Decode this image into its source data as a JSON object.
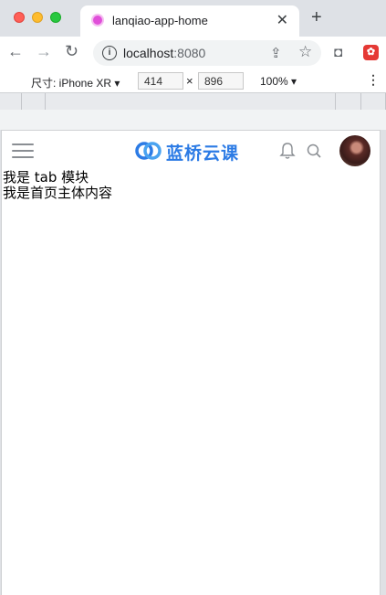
{
  "browser": {
    "tab_title": "lanqiao-app-home",
    "url_host": "localhost",
    "url_port": ":8080"
  },
  "device_toolbar": {
    "dimensions_label": "尺寸: iPhone XR ▾",
    "width": "414",
    "height": "896",
    "zoom": "100% ▾"
  },
  "app": {
    "logo_text": "蓝桥云课",
    "tab_module_text": "我是 tab 模块",
    "main_content_text": "我是首页主体内容"
  },
  "colors": {
    "brand": "#2c7be5"
  }
}
